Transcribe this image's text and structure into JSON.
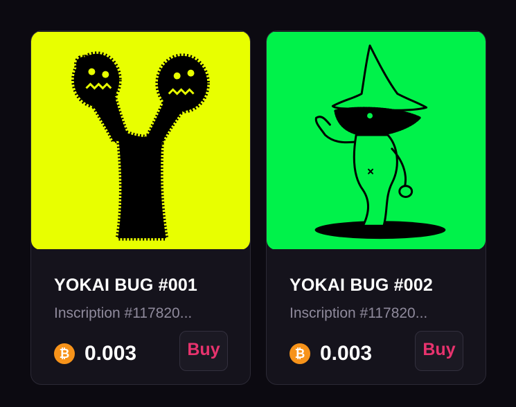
{
  "cards": [
    {
      "art": {
        "name": "yokai-bug-001-artwork",
        "bg": "#e8ff00"
      },
      "title": "YOKAI BUG #001",
      "inscription": "Inscription #117820...",
      "price": "0.003",
      "currency_icon": "bitcoin-icon",
      "currency_symbol": "₿",
      "buy_label": "Buy"
    },
    {
      "art": {
        "name": "yokai-bug-002-artwork",
        "bg": "#00f24a"
      },
      "title": "YOKAI BUG #002",
      "inscription": "Inscription #117820...",
      "price": "0.003",
      "currency_icon": "bitcoin-icon",
      "currency_symbol": "₿",
      "buy_label": "Buy"
    }
  ],
  "colors": {
    "page_bg": "#0c0a11",
    "card_bg": "#15131c",
    "buy_text": "#e8336e",
    "bitcoin": "#f7931a"
  }
}
